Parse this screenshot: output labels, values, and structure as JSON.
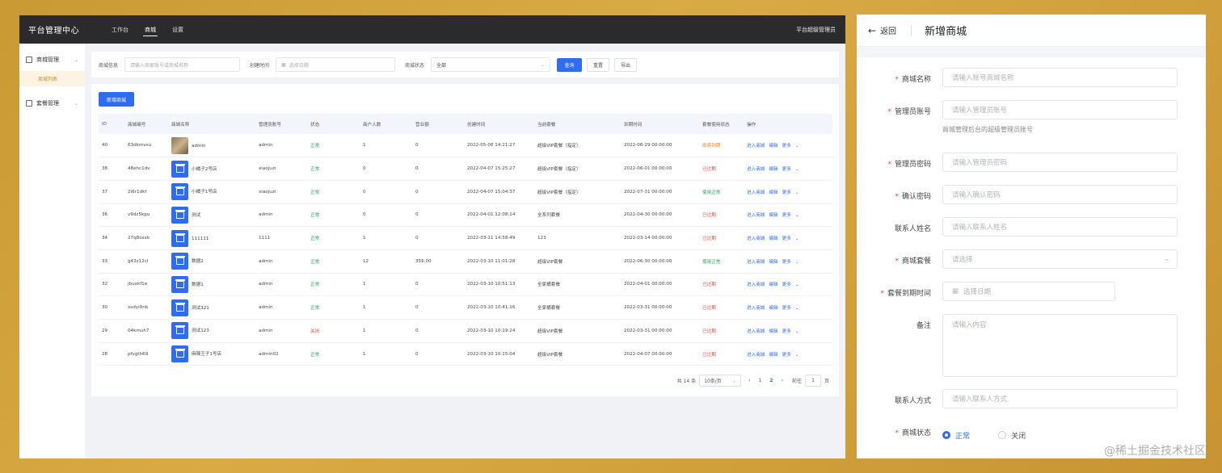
{
  "left": {
    "brand": "平台管理中心",
    "top_tabs": [
      {
        "label": "工作台",
        "active": false
      },
      {
        "label": "商城",
        "active": true
      },
      {
        "label": "设置",
        "active": false
      }
    ],
    "top_right_user": "平台超级管理员",
    "sidebar": {
      "groups": [
        {
          "label": "商城管理",
          "sub": "商城列表"
        },
        {
          "label": "套餐管理"
        }
      ]
    },
    "filter": {
      "info_label": "商城信息",
      "info_placeholder": "请输入商家账号或商城名称",
      "time_label": "创建时间",
      "time_placeholder": "选择日期",
      "status_label": "商城状态",
      "status_value": "全部",
      "query": "查询",
      "reset": "重置",
      "export": "导出"
    },
    "add_button": "新增商城",
    "columns": [
      "ID",
      "商城编号",
      "商城名称",
      "管理员账号",
      "状态",
      "商户人数",
      "营业额",
      "创建时间",
      "当前套餐",
      "到期时间",
      "套餐使用状态",
      "操作"
    ],
    "rows": [
      {
        "id": "40",
        "code": "63dkmvsu",
        "name": "admin",
        "photo": true,
        "admin": "admin",
        "status": "正常",
        "status_c": "green",
        "users": "1",
        "revenue": "0",
        "created": "2022-05-06 14:21:27",
        "pkg": "超级VIP套餐（指定）",
        "expire": "2022-06-29 00:00:00",
        "pkg_status": "即将到期",
        "pkg_c": "orange"
      },
      {
        "id": "38",
        "code": "48ehc1dv",
        "name": "小橘子2号店",
        "photo": false,
        "admin": "xiaojuzi",
        "status": "正常",
        "status_c": "green",
        "users": "0",
        "revenue": "0",
        "created": "2022-04-07 15:25:27",
        "pkg": "超级VIP套餐（指定）",
        "expire": "2022-06-01 00:00:00",
        "pkg_status": "已过期",
        "pkg_c": "red"
      },
      {
        "id": "37",
        "code": "2i6r1dkf",
        "name": "小橘子1号店",
        "photo": false,
        "admin": "xiaojuzi",
        "status": "正常",
        "status_c": "green",
        "users": "0",
        "revenue": "0",
        "created": "2022-04-07 15:04:37",
        "pkg": "超级VIP套餐（指定）",
        "expire": "2022-07-31 00:00:00",
        "pkg_status": "使用正常",
        "pkg_c": "green"
      },
      {
        "id": "36",
        "code": "v9dz5kgu",
        "name": "测试",
        "photo": false,
        "admin": "admin",
        "status": "正常",
        "status_c": "green",
        "users": "0",
        "revenue": "0",
        "created": "2022-04-01 12:08:14",
        "pkg": "全系列套餐",
        "expire": "2022-04-30 00:00:00",
        "pkg_status": "已过期",
        "pkg_c": "red"
      },
      {
        "id": "34",
        "code": "27q8sxsb",
        "name": "111111",
        "photo": false,
        "admin": "1111",
        "status": "正常",
        "status_c": "green",
        "users": "1",
        "revenue": "0",
        "created": "2022-03-11 14:58:49",
        "pkg": "123",
        "expire": "2022-03-14 00:00:00",
        "pkg_status": "已过期",
        "pkg_c": "red"
      },
      {
        "id": "33",
        "code": "g43z12cl",
        "name": "数据2",
        "photo": false,
        "admin": "admin",
        "status": "正常",
        "status_c": "green",
        "users": "12",
        "revenue": "356.00",
        "created": "2022-03-10 11:01:28",
        "pkg": "超级VIP套餐",
        "expire": "2022-06-30 00:00:00",
        "pkg_status": "使用正常",
        "pkg_c": "green"
      },
      {
        "id": "32",
        "code": "jbuxkf1e",
        "name": "数据1",
        "photo": false,
        "admin": "admin",
        "status": "正常",
        "status_c": "green",
        "users": "1",
        "revenue": "0",
        "created": "2022-03-10 10:51:13",
        "pkg": "全家桶套餐",
        "expire": "2022-04-01 00:00:00",
        "pkg_status": "已过期",
        "pkg_c": "red"
      },
      {
        "id": "30",
        "code": "xsdyi9nb",
        "name": "测试321",
        "photo": false,
        "admin": "admin",
        "status": "正常",
        "status_c": "green",
        "users": "1",
        "revenue": "0",
        "created": "2022-03-10 10:41:16",
        "pkg": "全家桶套餐",
        "expire": "2022-03-31 00:00:00",
        "pkg_status": "已过期",
        "pkg_c": "red"
      },
      {
        "id": "29",
        "code": "04kmuh7",
        "name": "测试123",
        "photo": false,
        "admin": "admin",
        "status": "关闭",
        "status_c": "red",
        "users": "1",
        "revenue": "0",
        "created": "2022-03-10 10:19:24",
        "pkg": "超级VIP套餐",
        "expire": "2022-03-31 00:00:00",
        "pkg_status": "已过期",
        "pkg_c": "red"
      },
      {
        "id": "28",
        "code": "pfvgth69",
        "name": "麻辣王子1号店",
        "photo": false,
        "admin": "admin02",
        "status": "正常",
        "status_c": "green",
        "users": "1",
        "revenue": "0",
        "created": "2022-03-10 10:15:04",
        "pkg": "超级VIP套餐",
        "expire": "2022-04-07 00:00:00",
        "pkg_status": "已过期",
        "pkg_c": "red"
      }
    ],
    "ops": {
      "enter": "进入商城",
      "edit": "编辑",
      "more": "更多"
    },
    "pager": {
      "total": "共 14 条",
      "size": "10条/页",
      "pages": [
        "1",
        "2"
      ],
      "current": "2",
      "goto": "前往",
      "goto_value": "1",
      "page_unit": "页"
    }
  },
  "right": {
    "back": "返回",
    "title": "新增商城",
    "fields": [
      {
        "label": "商城名称",
        "required": true,
        "placeholder": "请输入账号商城名称"
      },
      {
        "label": "管理员账号",
        "required": true,
        "placeholder": "请输入管理员账号",
        "hint": "商城管理后台的超级管理员账号"
      },
      {
        "label": "管理员密码",
        "required": true,
        "placeholder": "请输入管理员密码"
      },
      {
        "label": "确认密码",
        "required": true,
        "placeholder": "请输入确认密码"
      },
      {
        "label": "联系人姓名",
        "required": false,
        "placeholder": "请输入联系人姓名"
      },
      {
        "label": "商城套餐",
        "required": true,
        "placeholder": "请选择"
      },
      {
        "label": "套餐到期时间",
        "required": true,
        "placeholder": "选择日期"
      },
      {
        "label": "备注",
        "required": false,
        "placeholder": "请输入内容"
      },
      {
        "label": "联系人方式",
        "required": false,
        "placeholder": "请输入联系人方式"
      },
      {
        "label": "商城状态",
        "required": true
      }
    ],
    "status_options": [
      {
        "label": "正常",
        "checked": true
      },
      {
        "label": "关闭",
        "checked": false
      }
    ]
  },
  "watermark": "@稀土掘金技术社区",
  "colors": {
    "primary": "#2e6cf5",
    "topbar": "#2b2b2d",
    "green": "#1ea858",
    "red": "#e94747",
    "orange": "#e67e22",
    "frame": "#c99a33"
  }
}
